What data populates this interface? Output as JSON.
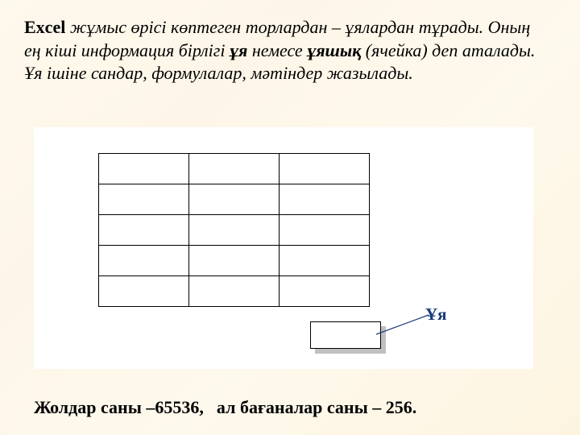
{
  "paragraph": {
    "lead": "Excel",
    "part1": " жұмыс өрісі көптеген торлардан – ұялардан тұрады. Оның ең кіші информация бірлігі ",
    "term1": "ұя",
    "part2": " немесе ",
    "term2": "ұяшық",
    "part3": " (ячейка) деп аталады. Ұя ішіне сандар, формулалар, мәтіндер жазылады."
  },
  "illustration": {
    "rows": 5,
    "cols": 3,
    "cell_label": "Ұя"
  },
  "footer": {
    "rows_text": "Жолдар саны –65536,",
    "cols_text": "ал бағаналар саны – 256."
  },
  "chart_data": {
    "type": "table",
    "description": "Empty illustrative Excel-like grid",
    "rows": 5,
    "cols": 3,
    "cells": "empty",
    "related_facts": {
      "total_rows": 65536,
      "total_columns": 256
    }
  }
}
